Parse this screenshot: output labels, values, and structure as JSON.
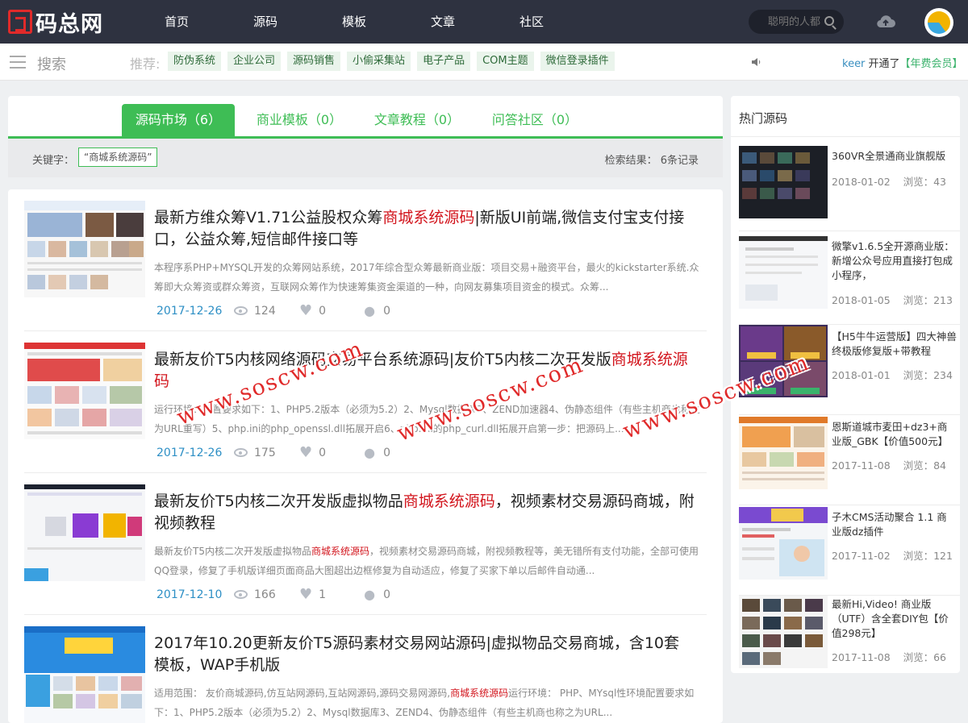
{
  "header": {
    "logo_text": "码总网",
    "nav": [
      "首页",
      "源码",
      "模板",
      "文章",
      "社区"
    ],
    "search_placeholder": "聪明的人都",
    "icons": [
      "search-icon",
      "cloud-upload-icon",
      "avatar"
    ]
  },
  "subbar": {
    "search_label": "搜索",
    "recommend_label": "推荐:",
    "tags": [
      "防伪系统",
      "企业公司",
      "源码销售",
      "小偷采集站",
      "电子产品",
      "COM主题",
      "微信登录插件"
    ],
    "notice": {
      "user": "keer",
      "action": " 开通了",
      "membership": "【年费会员】"
    }
  },
  "search": {
    "tabs": [
      {
        "label": "源码市场（6）",
        "active": true
      },
      {
        "label": "商业模板（0）",
        "active": false
      },
      {
        "label": "文章教程（0）",
        "active": false
      },
      {
        "label": "问答社区（0）",
        "active": false
      }
    ],
    "keyword_label": "关键字：",
    "keyword": "“商城系统源码”",
    "result_label": "检索结果：",
    "result_count": "6条记录"
  },
  "items": [
    {
      "title_pre": "最新方维众筹V1.71公益股权众筹",
      "title_hl": "商城系统源码",
      "title_post": "|新版UI前端,微信支付宝支付接口，公益众筹,短信邮件接口等",
      "desc_pre": "本程序系PHP+MYSQL开发的众筹网站系统，2017年综合型众筹最新商业版：项目交易+融资平台，最火的kickstarter系统.众筹即大众筹资或群众筹资，互联网众筹作为快速筹集资金渠道的一种，向网友募集项目资金的模式。众筹...",
      "desc_hl": "",
      "desc_post": "",
      "date": "2017-12-26",
      "views": "124",
      "likes": "0",
      "comments": "0"
    },
    {
      "title_pre": "最新友价T5内核网络源码交易平台系统源码|友价T5内核二次开发版",
      "title_hl": "商城系统源码",
      "title_post": "",
      "desc_pre": "运行环境：配置要求如下：1、PHP5.2版本（必须为5.2）2、Mysql数据库3、ZEND加速器4、伪静态组件（有些主机商也称之为URL重写）5、php.ini的php_openssl.dll拓展开启6、php.ini的php_curl.dll拓展开启第一步：把源码上...",
      "desc_hl": "",
      "desc_post": "",
      "date": "2017-12-26",
      "views": "175",
      "likes": "0",
      "comments": "0"
    },
    {
      "title_pre": "最新友价T5内核二次开发版虚拟物品",
      "title_hl": "商城系统源码",
      "title_post": "，视频素材交易源码商城，附视频教程",
      "desc_pre": "最新友价T5内核二次开发版虚拟物品",
      "desc_hl": "商城系统源码",
      "desc_post": "，视频素材交易源码商城，附视频教程等，美无错所有支付功能，全部可使用QQ登录，修复了手机版详细页面商品大图超出边框修复为自动适应，修复了买家下单以后邮件自动通...",
      "date": "2017-12-10",
      "views": "166",
      "likes": "1",
      "comments": "0"
    },
    {
      "title_pre": "2017年10.20更新友价T5源码素材交易网站源码|虚拟物品交易商城，含10套模板，WAP手机版",
      "title_hl": "",
      "title_post": "",
      "desc_pre": "适用范围： 友价商城源码,仿互站网源码,互站网源码,源码交易网源码,",
      "desc_hl": "商城系统源码",
      "desc_post": "运行环境： PHP、MYsql性环境配置要求如下：1、PHP5.2版本（必须为5.2）2、Mysql数据库3、ZEND4、伪静态组件（有些主机商也称之为URL...",
      "date": "",
      "views": "",
      "likes": "",
      "comments": ""
    }
  ],
  "sidebar": {
    "title": "热门源码",
    "views_label": "浏览：",
    "items": [
      {
        "title": "360VR全景通商业旗舰版",
        "date": "2018-01-02",
        "views": "43"
      },
      {
        "title": "微擎v1.6.5全开源商业版：新增公众号应用直接打包成小程序，",
        "date": "2018-01-05",
        "views": "213"
      },
      {
        "title": "【H5牛牛运营版】四大神兽终极版修复版+带教程",
        "date": "2018-01-01",
        "views": "234"
      },
      {
        "title": "恩斯道城市麦田+dz3+商业版_GBK【价值500元】",
        "date": "2017-11-08",
        "views": "84"
      },
      {
        "title": "子木CMS活动聚合 1.1 商业版dz插件",
        "date": "2017-11-02",
        "views": "121"
      },
      {
        "title": "最新Hi,Video! 商业版（UTF）含全套DIY包【价值298元】",
        "date": "2017-11-08",
        "views": "66"
      }
    ]
  },
  "watermark": "www.soscw.com"
}
